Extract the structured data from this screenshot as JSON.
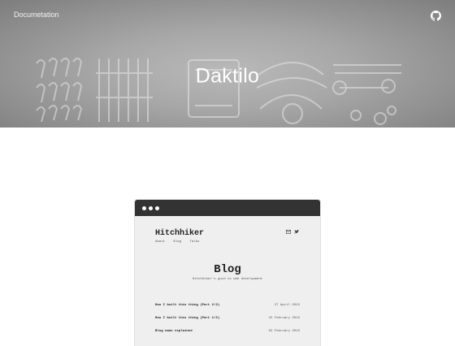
{
  "header": {
    "doc_link": "Documetation",
    "title": "Daktilo",
    "github_icon": "github-icon"
  },
  "preview": {
    "site_title": "Hitchhiker",
    "nav": [
      "About",
      "Blog",
      "Talks"
    ],
    "social_icons": [
      "mail-icon",
      "twitter-icon"
    ],
    "blog_title": "Blog",
    "blog_subtitle": "Hitchhiker's guid to web development",
    "posts": [
      {
        "title": "How I built this thing (Part 2/3)",
        "date": "27 April 2015"
      },
      {
        "title": "How I built this thing (Part 1/3)",
        "date": "15 February 2015"
      },
      {
        "title": "Blog name explained",
        "date": "02 February 2015"
      }
    ]
  }
}
